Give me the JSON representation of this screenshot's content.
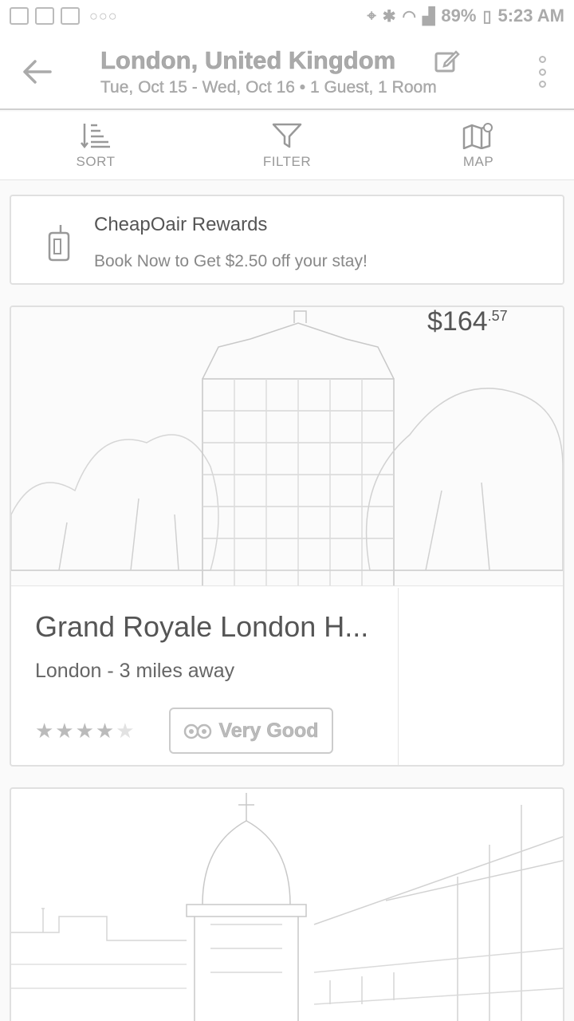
{
  "status_bar": {
    "battery": "89%",
    "time": "5:23 AM",
    "dots": "○○○"
  },
  "header": {
    "title": "London, United Kingdom",
    "subtitle": "Tue, Oct 15 - Wed, Oct 16 •  1 Guest, 1 Room"
  },
  "toolbar": {
    "sort_label": "SORT",
    "filter_label": "FILTER",
    "map_label": "MAP"
  },
  "rewards": {
    "title": "CheapOair Rewards",
    "text": "Book Now to Get $2.50 off your stay!"
  },
  "hotels": [
    {
      "name": "Grand Royale London H...",
      "distance": "London - 3 miles away",
      "stars_filled": "★★★★",
      "stars_empty": "★",
      "rating_text": "Very Good",
      "price_dollars": "$164",
      "price_cents": ".57"
    }
  ],
  "colors": {
    "background": "#fafafa",
    "card": "#ffffff",
    "text": "#555555",
    "muted": "#aaaaaa"
  }
}
